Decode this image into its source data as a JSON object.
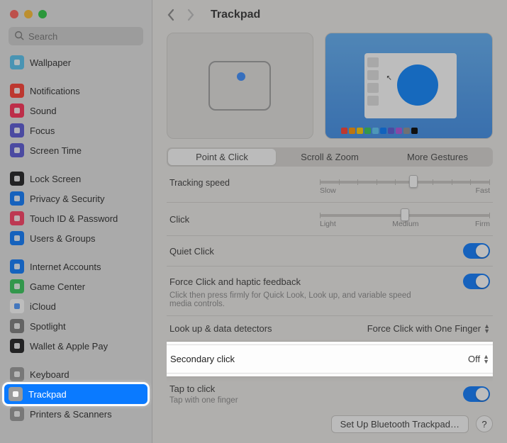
{
  "window": {
    "search_placeholder": "Search"
  },
  "sidebar": {
    "groups": [
      [
        {
          "label": "Wallpaper",
          "icon": "wallpaper",
          "bg": "#55c3f0"
        },
        null
      ],
      [
        {
          "label": "Notifications",
          "icon": "bell",
          "bg": "#ff3b30"
        },
        {
          "label": "Sound",
          "icon": "speaker",
          "bg": "#ff2d55"
        },
        {
          "label": "Focus",
          "icon": "moon",
          "bg": "#5856d6"
        },
        {
          "label": "Screen Time",
          "icon": "hourglass",
          "bg": "#5856d6"
        }
      ],
      [
        {
          "label": "Lock Screen",
          "icon": "lock",
          "bg": "#1c1c1e"
        },
        {
          "label": "Privacy & Security",
          "icon": "hand",
          "bg": "#0a7aff"
        },
        {
          "label": "Touch ID & Password",
          "icon": "fingerprint",
          "bg": "#ff3b62"
        },
        {
          "label": "Users & Groups",
          "icon": "users",
          "bg": "#0a7aff"
        }
      ],
      [
        {
          "label": "Internet Accounts",
          "icon": "at",
          "bg": "#0a7aff"
        },
        {
          "label": "Game Center",
          "icon": "game",
          "bg": "#34c759"
        },
        {
          "label": "iCloud",
          "icon": "cloud",
          "bg": "#ffffff"
        },
        {
          "label": "Spotlight",
          "icon": "search",
          "bg": "#7d7d7d"
        },
        {
          "label": "Wallet & Apple Pay",
          "icon": "wallet",
          "bg": "#1c1c1e"
        }
      ],
      [
        {
          "label": "Keyboard",
          "icon": "keyboard",
          "bg": "#9a9a9a"
        },
        {
          "label": "Trackpad",
          "icon": "trackpad",
          "bg": "#9a9a9a",
          "selected": true,
          "highlight": true
        },
        {
          "label": "Printers & Scanners",
          "icon": "printer",
          "bg": "#9a9a9a"
        }
      ]
    ]
  },
  "page": {
    "title": "Trackpad",
    "tabs": [
      "Point & Click",
      "Scroll & Zoom",
      "More Gestures"
    ],
    "active_tab": 0
  },
  "preview": {
    "swatches": [
      "#ff3b30",
      "#ff9500",
      "#ffcc00",
      "#34c759",
      "#5ac8fa",
      "#007aff",
      "#5856d6",
      "#af52de",
      "#8e8e93",
      "#000000"
    ]
  },
  "settings": {
    "tracking_speed": {
      "label": "Tracking speed",
      "min_label": "Slow",
      "max_label": "Fast",
      "value_pct": 55
    },
    "click": {
      "label": "Click",
      "labels": [
        "Light",
        "Medium",
        "Firm"
      ],
      "value_pct": 50
    },
    "quiet_click": {
      "label": "Quiet Click",
      "on": true
    },
    "force_click": {
      "label": "Force Click and haptic feedback",
      "sub": "Click then press firmly for Quick Look, Look up, and variable speed media controls.",
      "on": true
    },
    "lookup": {
      "label": "Look up & data detectors",
      "value": "Force Click with One Finger"
    },
    "secondary": {
      "label": "Secondary click",
      "value": "Off"
    },
    "tap_to_click": {
      "label": "Tap to click",
      "sub": "Tap with one finger",
      "on": true
    }
  },
  "footer": {
    "bluetooth_btn": "Set Up Bluetooth Trackpad…"
  }
}
